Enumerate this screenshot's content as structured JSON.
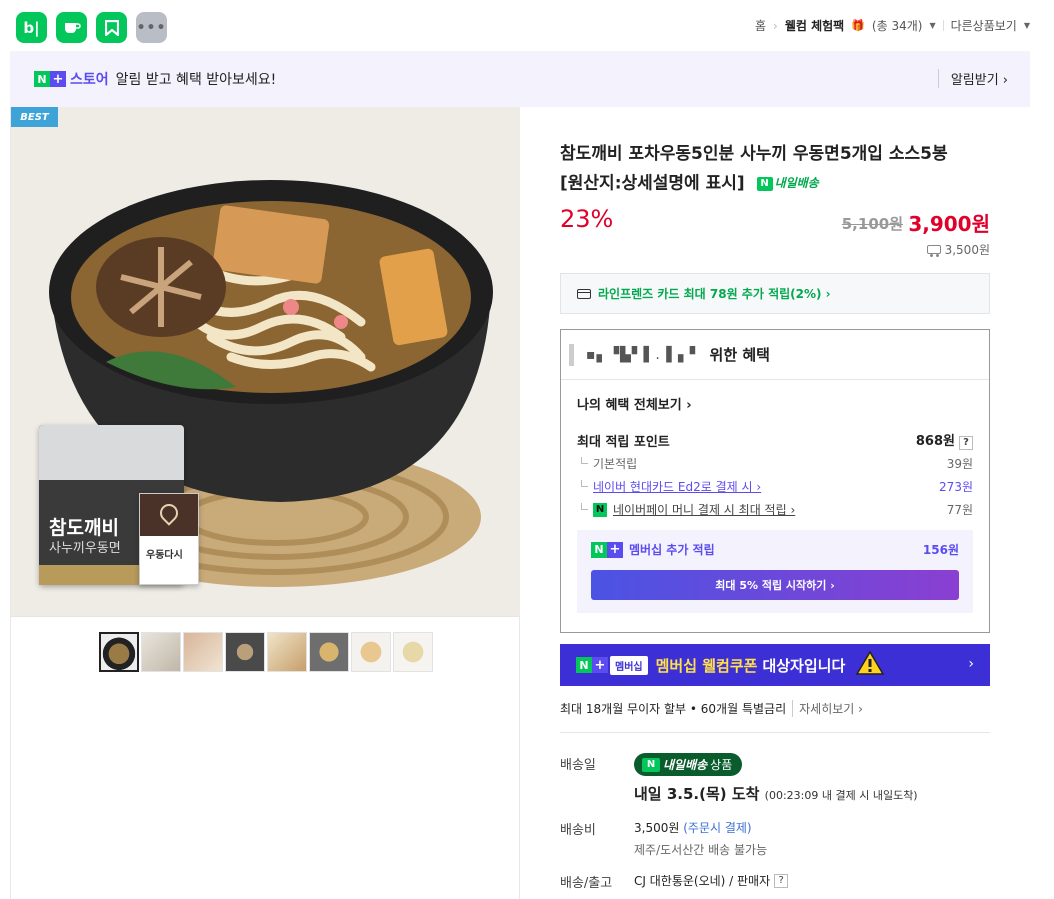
{
  "topbar": {
    "apps": [
      {
        "name": "blog-icon",
        "glyph": "b|"
      },
      {
        "name": "cafe-icon",
        "glyph": "☕"
      },
      {
        "name": "bookmark-icon",
        "glyph": "⚑"
      },
      {
        "name": "more-icon",
        "glyph": "•••"
      }
    ],
    "breadcrumb": {
      "home": "홈",
      "category": "웰컴 체험팩",
      "count": "(총 34개)",
      "other": "다른상품보기"
    }
  },
  "banner": {
    "n": "N",
    "plus": "+",
    "store": "스토어",
    "message": "알림 받고 혜택 받아보세요!",
    "subscribe": "알림받기 ›"
  },
  "gallery": {
    "badge": "BEST",
    "package_brand": "참도깨비",
    "package_sub": "사누끼우동면",
    "sauce_label": "우동다시",
    "thumbnail_count": 8
  },
  "product": {
    "title_line1": "참도깨비 포차우동5인분 사누끼 우동면5개입 소스5봉",
    "title_line2": "[원산지:상세설명에 표시]",
    "delivery_badge": "내일배송",
    "discount": "23%",
    "original_price": "5,100원",
    "price": "3,900원",
    "shipping_fee": "3,500원"
  },
  "card_offer": "라인프렌즈 카드 최대 78원 추가 적립(2%) ›",
  "benefit": {
    "user_masked": "▪︎▖▝▙▘▌. ▌▖▘",
    "title": "위한 혜택",
    "view_all": "나의 혜택 전체보기 ›",
    "max_point_label": "최대 적립 포인트",
    "max_point_value": "868원",
    "basic_label": "기본적립",
    "basic_value": "39원",
    "card_label": "네이버 현대카드 Ed2로 결제 시 ›",
    "card_value": "273원",
    "pay_label": "네이버페이 머니 결제 시 최대 적립 ›",
    "pay_value": "77원",
    "member_label": "멤버십 추가 적립",
    "member_value": "156원",
    "member_button": "최대 5% 적립 시작하기 ›"
  },
  "coupon": {
    "chip": "멤버십",
    "yellow": "멤버십 웰컴쿠폰",
    "white": "대상자입니다"
  },
  "installment": {
    "text": "최대 18개월 무이자 할부 • 60개월 특별금리",
    "detail": "자세히보기 ›"
  },
  "delivery": {
    "date_label": "배송일",
    "badge": "내일배송",
    "badge_suffix": "상품",
    "arrival": "내일 3.5.(목) 도착",
    "arrival_note": "(00:23:09 내 결제 시 내일도착)",
    "fee_label": "배송비",
    "fee_value": "3,500원",
    "fee_note": "(주문시 결제)",
    "restriction": "제주/도서산간 배송 불가능",
    "carrier_label": "배송/출고",
    "carrier_value": "CJ 대한통운(오네) / 판매자"
  }
}
